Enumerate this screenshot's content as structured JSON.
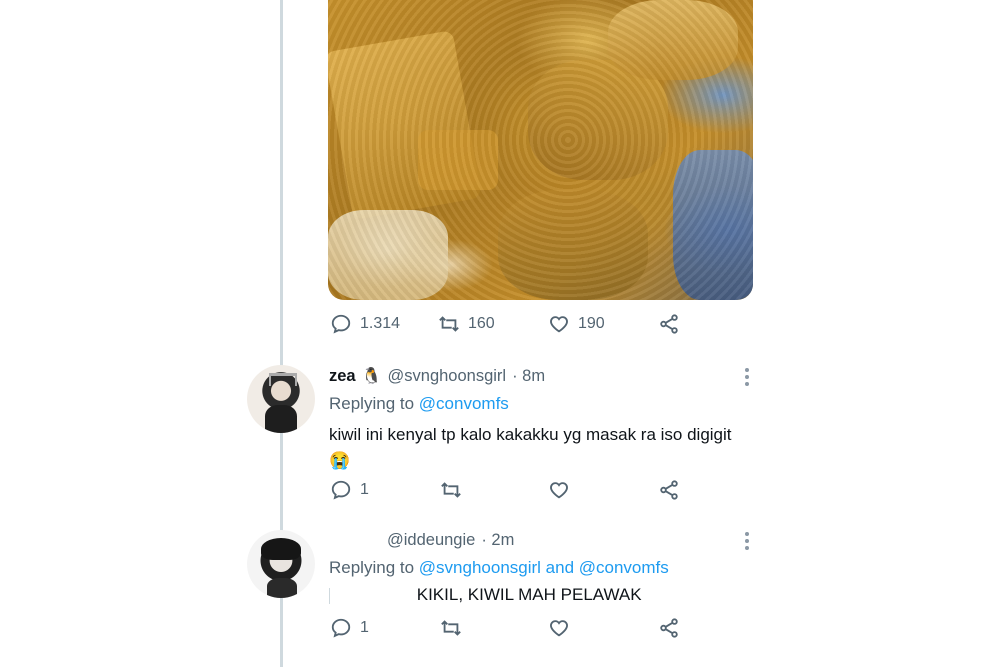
{
  "main_tweet": {
    "media_icon": "food-photo",
    "stats": {
      "replies": "1.314",
      "retweets": "160",
      "likes": "190"
    }
  },
  "replies": [
    {
      "name": "zea",
      "name_emoji": "🐧",
      "handle": "@svnghoonsgirl",
      "time": "· 8m",
      "replying_label": "Replying to",
      "replying_to": "@convomfs",
      "text": "kiwil ini kenyal tp kalo kakakku yg masak ra iso digigit",
      "text_emoji": "😭",
      "reply_count": "1"
    },
    {
      "handle": "@iddeungie",
      "time": "· 2m",
      "replying_label": "Replying to",
      "replying_to": "@svnghoonsgirl and @convomfs",
      "text": "KIKIL, KIWIL MAH PELAWAK",
      "reply_count": "1"
    }
  ],
  "icons": {
    "reply": "reply-icon",
    "retweet": "retweet-icon",
    "like": "heart-icon",
    "share": "share-icon",
    "more": "more-icon"
  },
  "colors": {
    "accent": "#1d9bf0",
    "muted": "#536471",
    "line": "#cfd9de"
  }
}
